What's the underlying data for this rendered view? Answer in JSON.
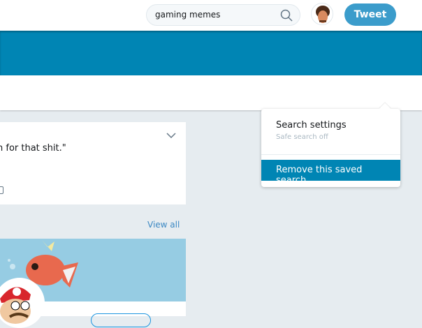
{
  "header": {
    "search_value": "gaming memes",
    "tweet_label": "Tweet"
  },
  "card": {
    "text": "n for that shit.\""
  },
  "section": {
    "view_all": "View all"
  },
  "menu": {
    "search_settings": "Search settings",
    "safe_search": "Safe search off",
    "remove": "Remove this saved search"
  },
  "colors": {
    "accent": "#0085b4",
    "tweet": "#3b9ccb",
    "bg": "#e6ecf0"
  }
}
